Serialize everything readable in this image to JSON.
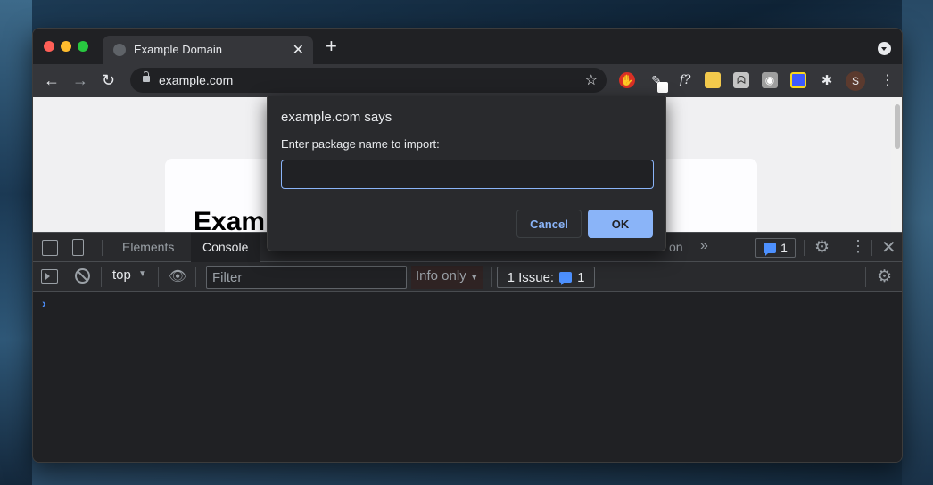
{
  "browser": {
    "tab": {
      "title": "Example Domain",
      "close_glyph": "✕"
    },
    "new_tab_glyph": "+",
    "url": "example.com",
    "avatar_initial": "S",
    "extensions": [
      "hand-stop-icon",
      "pen-icon",
      "function-icon",
      "sticky-note-icon",
      "ghost-icon",
      "camera-icon",
      "swap-icon",
      "puzzle-icon"
    ]
  },
  "page": {
    "heading_visible": "Exam"
  },
  "devtools": {
    "tabs": [
      {
        "label": "Elements"
      },
      {
        "label": "Console"
      },
      {
        "label": "on"
      }
    ],
    "issues_badge_count": "1",
    "console": {
      "context": "top",
      "filter_placeholder": "Filter",
      "levels": "Info only",
      "issues_label": "1 Issue:",
      "issues_count": "1",
      "prompt": "›"
    }
  },
  "dialog": {
    "title": "example.com says",
    "message": "Enter package name to import:",
    "input_value": "",
    "cancel_label": "Cancel",
    "ok_label": "OK"
  },
  "colors": {
    "accent": "#8ab4f8",
    "close_red": "#ff5f57",
    "minimize_yellow": "#febc2e",
    "maximize_green": "#28c840"
  }
}
